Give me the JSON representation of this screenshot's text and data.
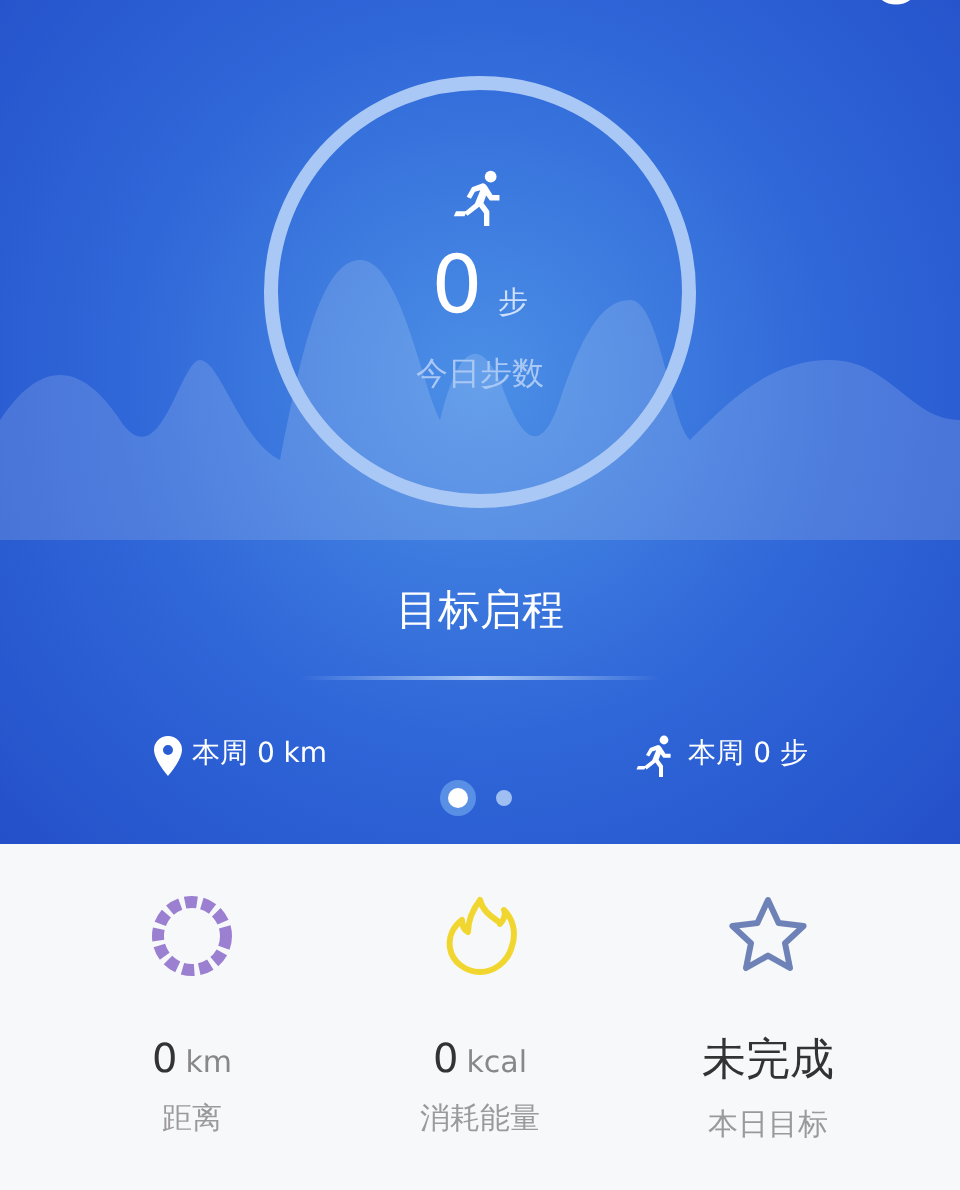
{
  "today": {
    "value": "0",
    "unit": "步",
    "label": "今日步数"
  },
  "goal_title": "目标启程",
  "weekly": [
    {
      "kind": "distance",
      "text": "本周 0 km"
    },
    {
      "kind": "steps",
      "text": "本周 0 步"
    }
  ],
  "pages": [
    {
      "selected": true
    },
    {
      "selected": false
    }
  ],
  "stats": [
    {
      "kind": "distance",
      "value": "0",
      "unit": "km",
      "label": "距离"
    },
    {
      "kind": "calories",
      "value": "0",
      "unit": "kcal",
      "label": "消耗能量"
    },
    {
      "kind": "goal",
      "value": "未完成",
      "label": "本日目标"
    }
  ]
}
